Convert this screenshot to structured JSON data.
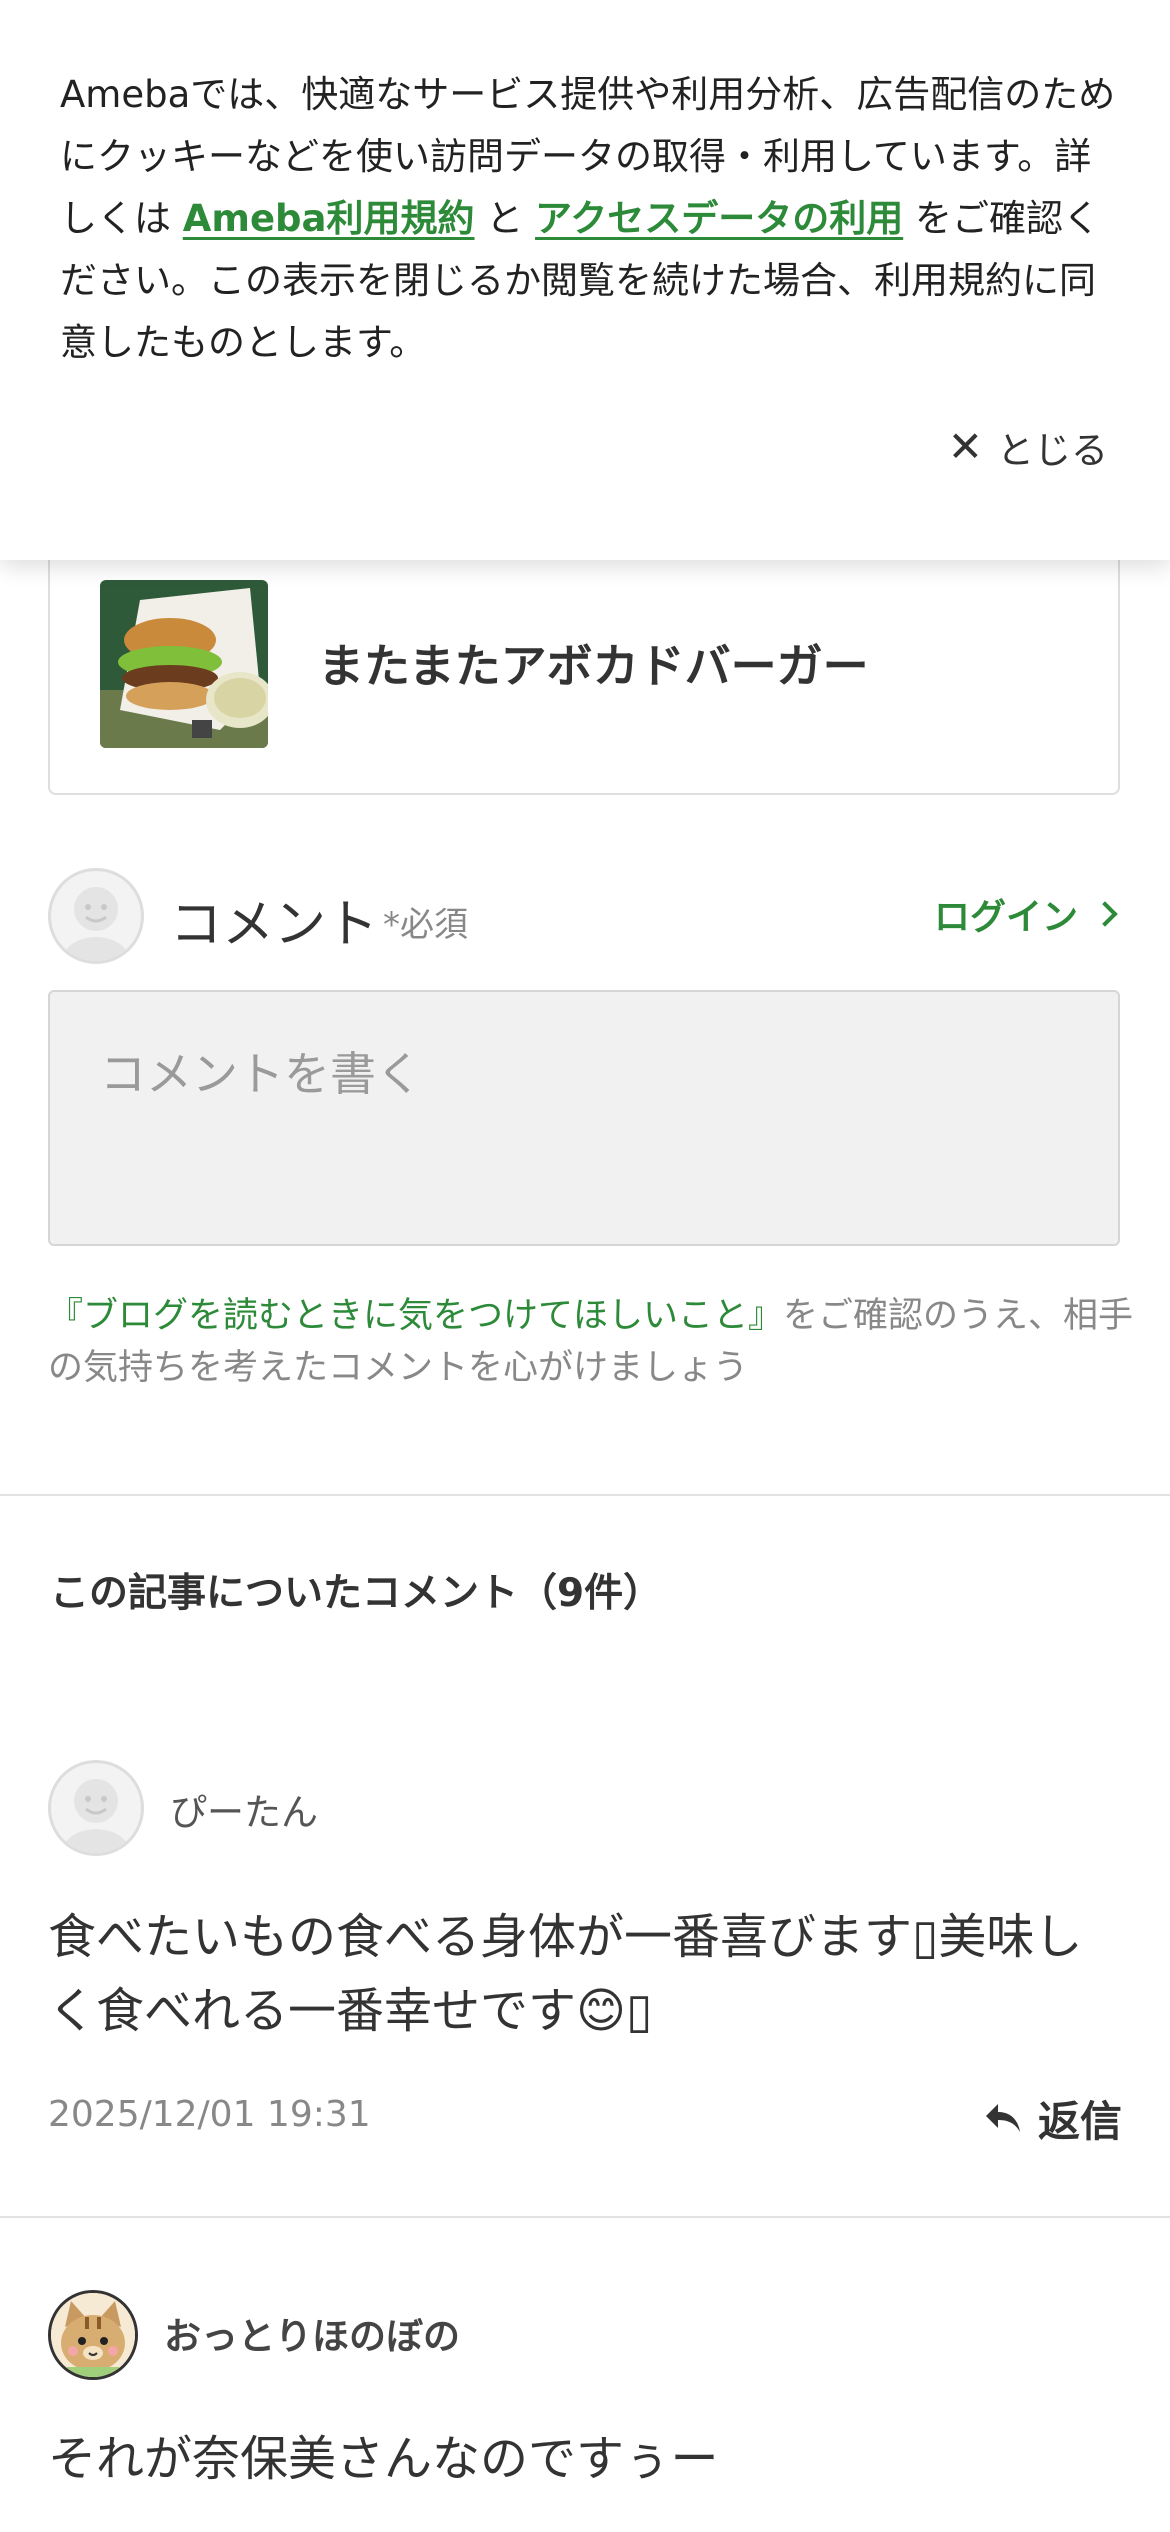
{
  "cookie": {
    "text_before": "Amebaでは、快適なサービス提供や利用分析、広告配信のためにクッキーなどを使い訪問データの取得・利用しています。詳しくは ",
    "link_terms": "Ameba利用規約",
    "text_and": " と ",
    "link_access": "アクセスデータの利用",
    "text_after": " をご確認ください。この表示を閉じるか閲覧を続けた場合、利用規約に同意したものとします。",
    "close_label": "とじる"
  },
  "article": {
    "title": "またまたアボカドバーガー"
  },
  "comment_form": {
    "label": "コメント",
    "required": "*必須",
    "login": "ログイン",
    "placeholder": "コメントを書く",
    "guideline_link": "『ブログを読むときに気をつけてほしいこと』",
    "guideline_text": "をご確認のうえ、相手の気持ちを考えたコメントを心がけましょう"
  },
  "comments": {
    "section_title": "この記事についたコメント（9件）",
    "items": [
      {
        "name": "ぴーたん",
        "body": "食べたいもの食べる身体が一番喜びます▯美味しく食べれる一番幸せです😊▯",
        "date": "2025/12/01 19:31",
        "reply": "返信"
      },
      {
        "name": "おっとりほのぼの",
        "body": "それが奈保美さんなのですぅー"
      }
    ]
  },
  "colors": {
    "accent_green": "#2d8a39",
    "text": "#333333",
    "muted": "#888888"
  },
  "icons": [
    "close-icon",
    "chevron-right-icon",
    "default-avatar-icon",
    "reply-arrow-icon",
    "cat-avatar-icon"
  ]
}
